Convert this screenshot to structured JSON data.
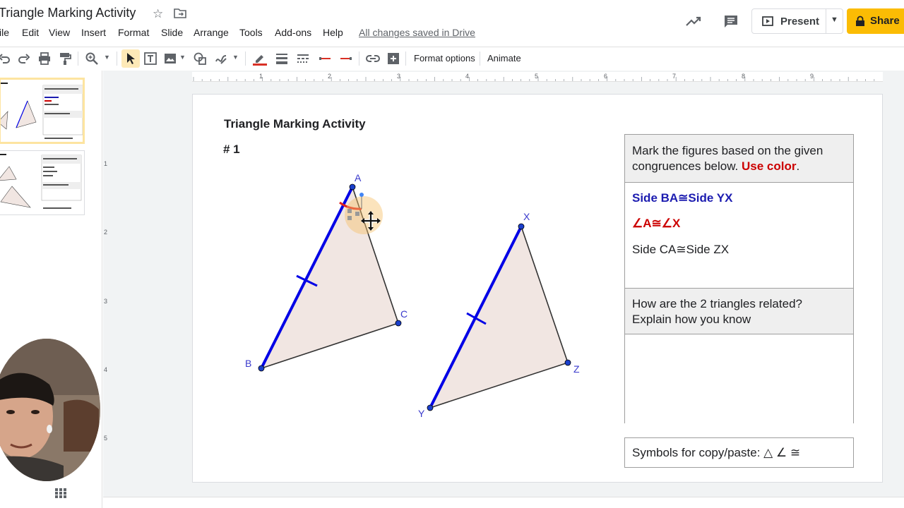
{
  "app": {
    "title": "Triangle Marking Activity",
    "saved_status": "All changes saved in Drive"
  },
  "menu": [
    "File",
    "Edit",
    "View",
    "Insert",
    "Format",
    "Slide",
    "Arrange",
    "Tools",
    "Add-ons",
    "Help"
  ],
  "menu_display": [
    "ile",
    "Edit",
    "View",
    "Insert",
    "Format",
    "Slide",
    "Arrange",
    "Tools",
    "Add-ons",
    "Help"
  ],
  "header": {
    "present_label": "Present",
    "share_label": "Share"
  },
  "toolbar": {
    "format_options": "Format options",
    "animate": "Animate",
    "icons": [
      "undo-icon",
      "redo-icon",
      "print-icon",
      "paint-format-icon",
      "zoom-icon",
      "select-icon",
      "textbox-icon",
      "image-icon",
      "shape-icon",
      "line-icon",
      "border-color-icon",
      "border-weight-icon",
      "border-dash-icon",
      "line-start-icon",
      "line-end-icon",
      "link-icon",
      "comment-add-icon"
    ],
    "border_color": "#d93025"
  },
  "ruler": {
    "h_labels": [
      "1",
      "2",
      "3",
      "4",
      "5",
      "6",
      "7",
      "8",
      "9"
    ],
    "v_labels": [
      "1",
      "2",
      "3",
      "4",
      "5"
    ]
  },
  "slide": {
    "title": "Triangle Marking Activity",
    "number": "# 1",
    "triangle1": {
      "labels": [
        "A",
        "B",
        "C"
      ]
    },
    "triangle2": {
      "labels": [
        "X",
        "Y",
        "Z"
      ]
    },
    "colors": {
      "fill": "#f1e6e2",
      "blue": "#0000e6",
      "point": "#1a3fcc",
      "label": "#3a3acc",
      "red_mark": "#e02020"
    },
    "table": {
      "instructions_prefix": "Mark the figures based on the given congruences below. ",
      "instructions_emph": "Use color",
      "instructions_suffix": ".",
      "congruence_1": "Side BA≅Side YX",
      "congruence_2": "∠A≅∠X",
      "congruence_3": "Side CA≅Side ZX",
      "question": "How are the 2 triangles related? Explain how you know",
      "answer": ""
    },
    "symbols": "Symbols for copy/paste: △ ∠ ≅"
  },
  "thumbnails": [
    {
      "title": "Triangle Marking Activity"
    },
    {
      "title": "Triangle Marking Activity"
    }
  ]
}
